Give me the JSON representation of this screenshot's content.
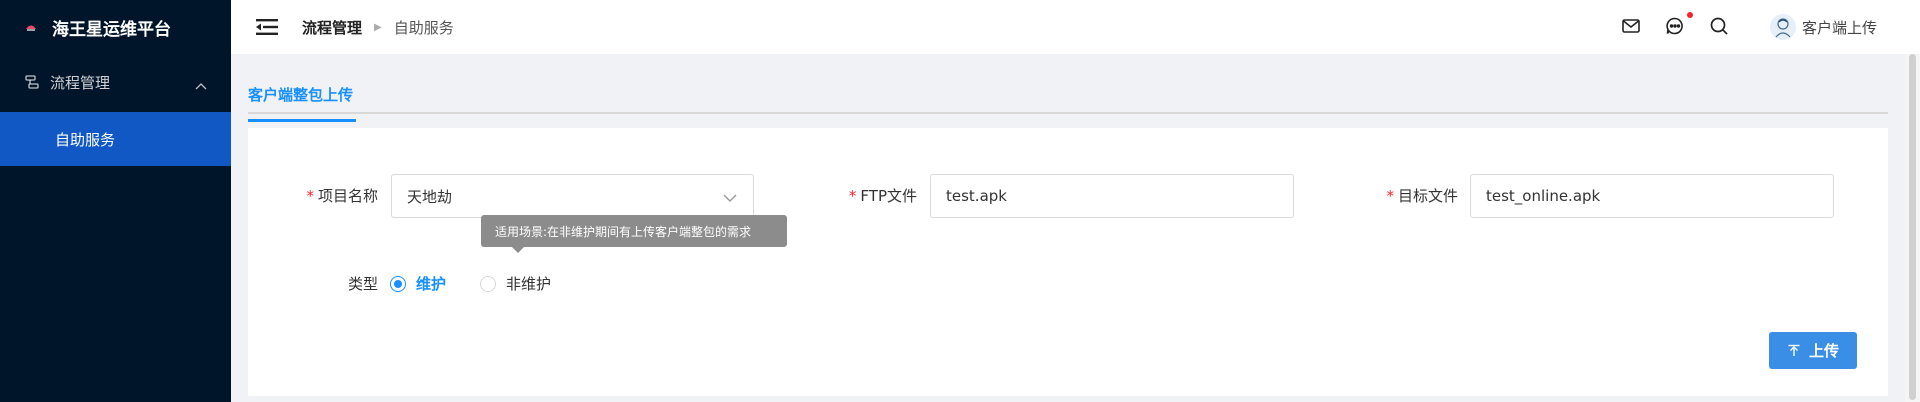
{
  "app": {
    "title": "海王星运维平台",
    "accent": "#1890ff",
    "sidebar_bg": "#001529",
    "active_menu_bg": "#1158c4"
  },
  "sidebar": {
    "groups": [
      {
        "label": "流程管理",
        "icon": "flow-icon",
        "expanded": true,
        "items": [
          {
            "label": "自助服务",
            "active": true
          }
        ]
      }
    ]
  },
  "header": {
    "breadcrumb": [
      "流程管理",
      "自助服务"
    ],
    "icons": [
      "mail-icon",
      "message-icon",
      "search-icon"
    ],
    "user": {
      "name": "客户端上传",
      "avatar": "avatar-icon"
    }
  },
  "tabs": [
    {
      "label": "客户端整包上传",
      "active": true
    }
  ],
  "form": {
    "project": {
      "label": "项目名称",
      "value": "天地劫",
      "required": true
    },
    "ftp": {
      "label": "FTP文件",
      "value": "test.apk",
      "required": true
    },
    "target": {
      "label": "目标文件",
      "value": "test_online.apk",
      "required": true
    },
    "tooltip": "适用场景:在非维护期间有上传客户端整包的需求",
    "type": {
      "label": "类型",
      "options": [
        {
          "label": "维护",
          "checked": true
        },
        {
          "label": "非维护",
          "checked": false
        }
      ]
    },
    "submit_label": "上传"
  }
}
